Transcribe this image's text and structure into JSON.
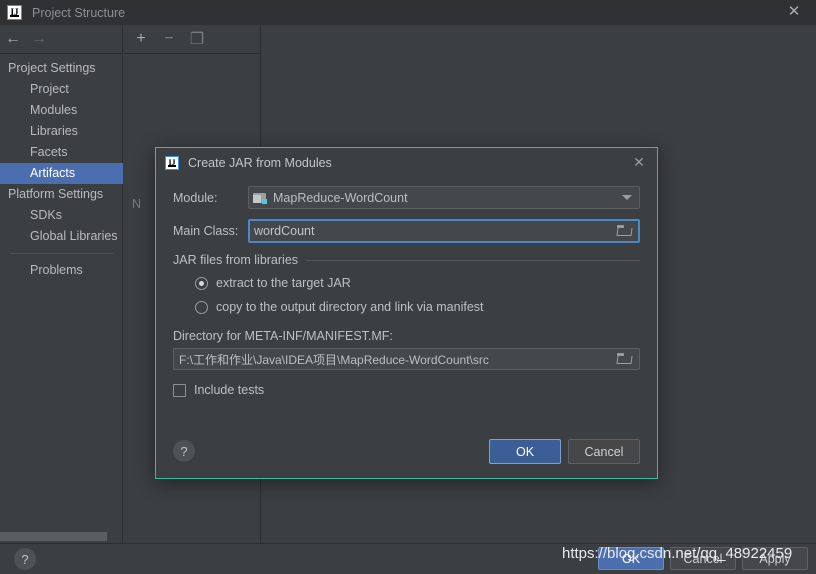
{
  "window": {
    "title": "Project Structure",
    "logo_text": "IJ",
    "close_icon": "✕",
    "back_icon": "←",
    "forward_icon": "→"
  },
  "sidebar": {
    "items": [
      {
        "label": "Project Settings",
        "type": "group",
        "selected": false
      },
      {
        "label": "Project",
        "type": "child",
        "selected": false
      },
      {
        "label": "Modules",
        "type": "child",
        "selected": false
      },
      {
        "label": "Libraries",
        "type": "child",
        "selected": false
      },
      {
        "label": "Facets",
        "type": "child",
        "selected": false
      },
      {
        "label": "Artifacts",
        "type": "child",
        "selected": true
      },
      {
        "label": "Platform Settings",
        "type": "group",
        "selected": false
      },
      {
        "label": "SDKs",
        "type": "child",
        "selected": false
      },
      {
        "label": "Global Libraries",
        "type": "child",
        "selected": false
      }
    ],
    "problems_label": "Problems"
  },
  "content": {
    "toolbar": {
      "add_icon": "+",
      "remove_icon": "−",
      "copy_icon": "❐"
    },
    "empty_hint": "N"
  },
  "dialog": {
    "title": "Create JAR from Modules",
    "logo_text": "IJ",
    "close_icon": "✕",
    "module_label": "Module:",
    "module_value": "MapReduce-WordCount",
    "main_class_label": "Main Class:",
    "main_class_value": "wordCount",
    "jar_group_label": "JAR files from libraries",
    "radio_extract_label": "extract to the target JAR",
    "radio_copy_label": "copy to the output directory and link via manifest",
    "manifest_dir_label": "Directory for META-INF/MANIFEST.MF:",
    "manifest_dir_value": "F:\\工作和作业\\Java\\IDEA项目\\MapReduce-WordCount\\src",
    "include_tests_label": "Include tests",
    "help_label": "?",
    "ok_label": "OK",
    "cancel_label": "Cancel",
    "accent_border": "#3bbba4",
    "focus_border": "#4a88c7",
    "primary_button_bg": "#3b5e96"
  },
  "bottom_bar": {
    "help_label": "?",
    "ok_label": "OK",
    "cancel_label": "Cancel",
    "apply_label": "Apply",
    "watermark": "https://blog.csdn.net/qq_48922459"
  }
}
